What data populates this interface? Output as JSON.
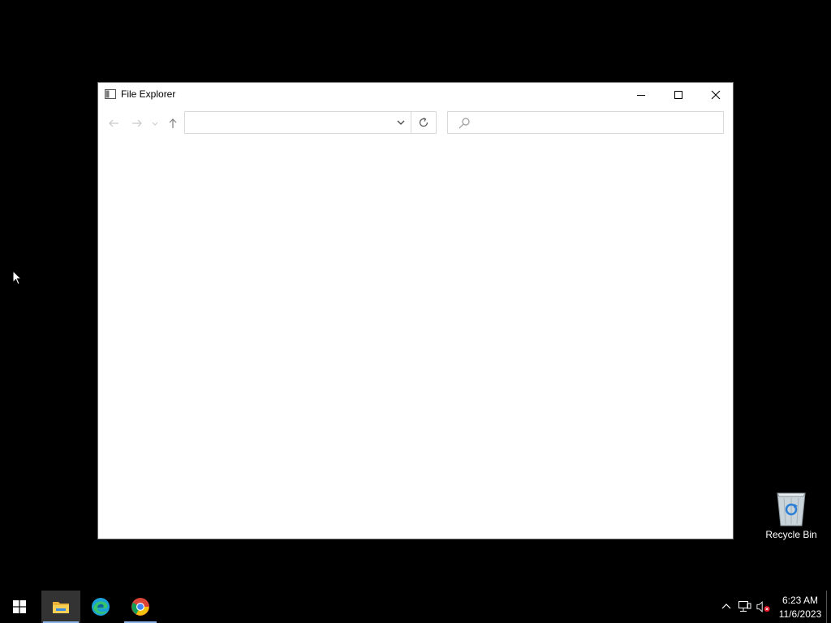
{
  "window": {
    "title": "File Explorer",
    "address": {
      "value": "",
      "placeholder": ""
    },
    "search": {
      "value": "",
      "placeholder": ""
    },
    "icons": {
      "app": "file-explorer-icon",
      "minimize": "minimize-icon",
      "maximize": "maximize-icon",
      "close": "close-icon",
      "back": "arrow-left-icon",
      "forward": "arrow-right-icon",
      "recent": "chevron-down-icon",
      "up": "arrow-up-icon",
      "address_dropdown": "chevron-down-icon",
      "refresh": "refresh-icon",
      "search": "search-icon"
    }
  },
  "desktop": {
    "recycle_bin_label": "Recycle Bin"
  },
  "taskbar": {
    "apps": [
      "start",
      "file-explorer",
      "edge",
      "chrome"
    ],
    "clock": {
      "time": "6:23 AM",
      "date": "11/6/2023"
    }
  },
  "colors": {
    "desktop": "#000000",
    "window": "#ffffff",
    "taskbar_active_indicator": "#8ab4e8",
    "windows_logo": "#ffffff"
  }
}
